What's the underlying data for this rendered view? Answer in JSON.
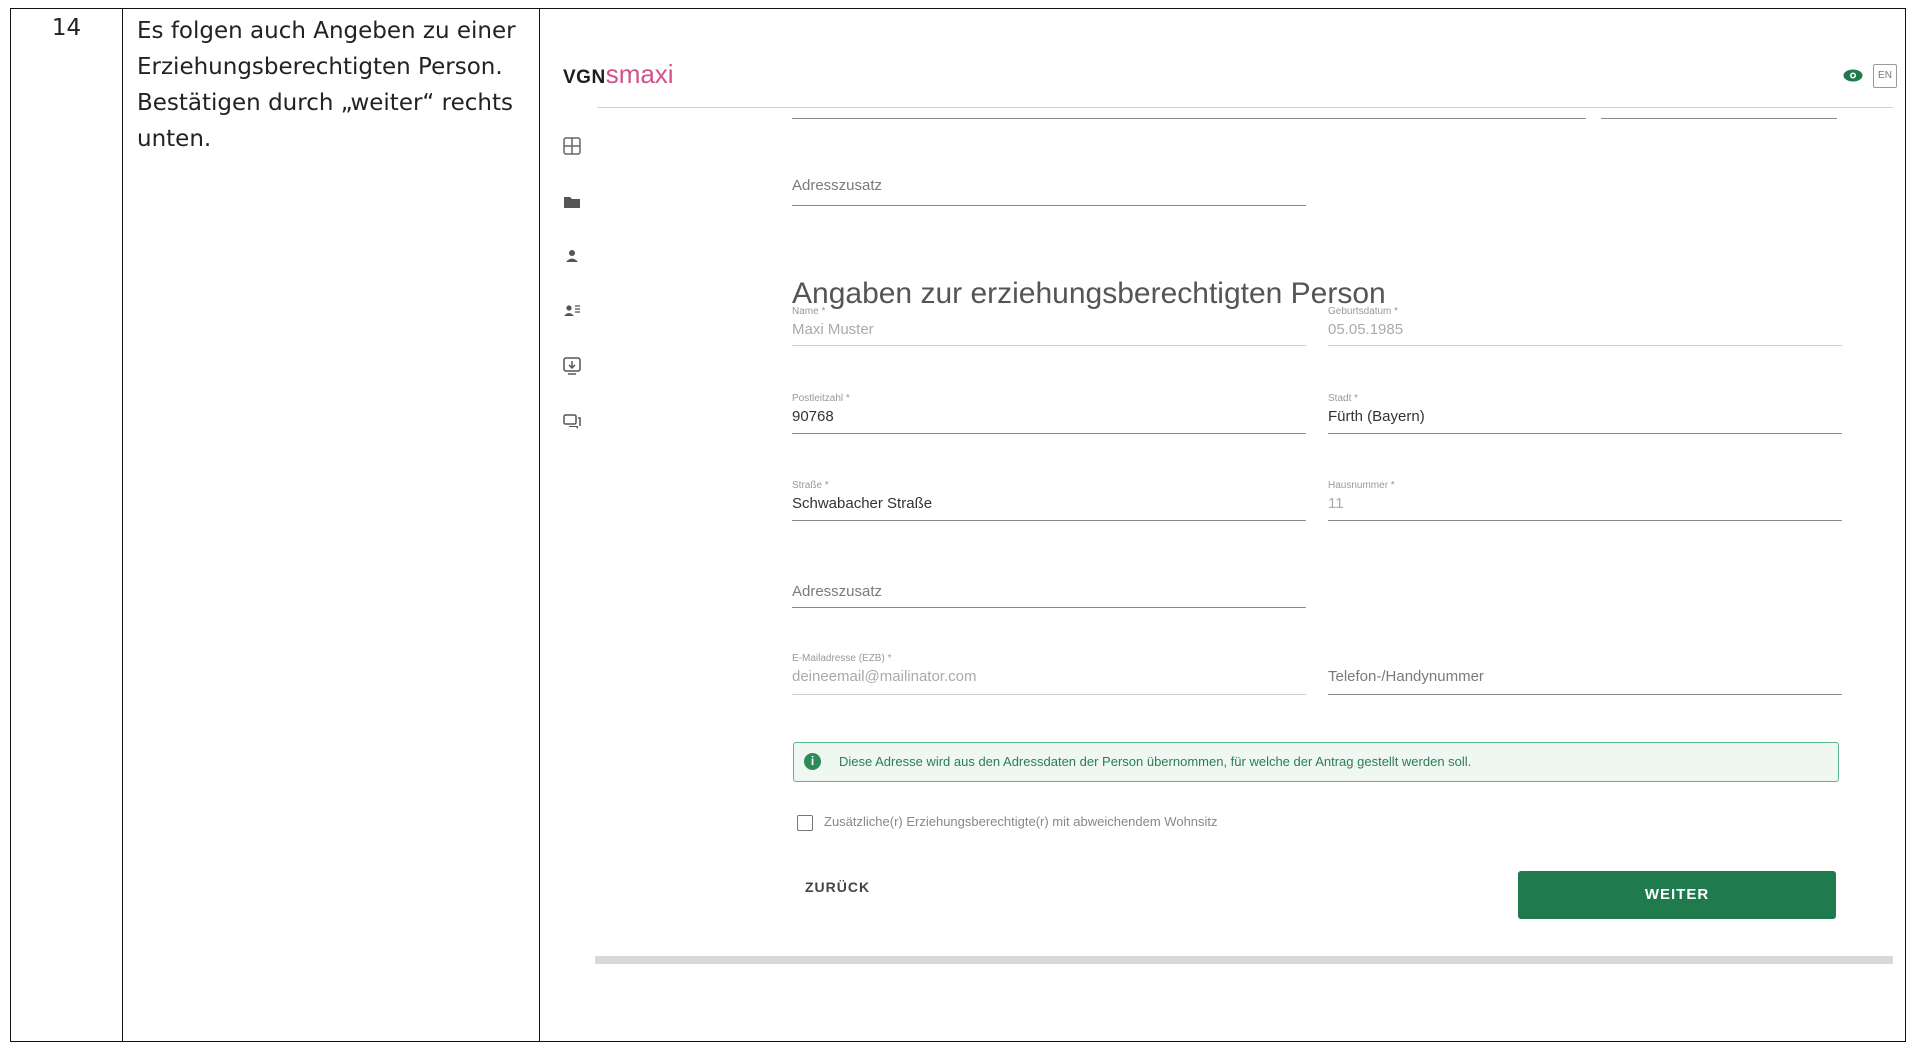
{
  "step": {
    "number": "14",
    "text": "Es folgen auch Angeben zu einer\nErziehungsberechtigten Person.\nBestätigen durch „weiter“ rechts\nunten."
  },
  "app": {
    "logo_vgn": "VGN",
    "logo_smaxi": "smaxi",
    "lang": "EN",
    "accent_color": "#1f7a4d",
    "brand_color": "#d4508a"
  },
  "sidebar": {
    "icons": [
      "dashboard-icon",
      "folder-icon",
      "person-icon",
      "person-list-icon",
      "download-icon",
      "chat-icon"
    ]
  },
  "form": {
    "address_extra_top": {
      "placeholder": "Adresszusatz"
    },
    "section_title": "Angaben zur erziehungsberechtigten Person",
    "name": {
      "label": "Name *",
      "value": "Maxi Muster"
    },
    "birthdate": {
      "label": "Geburtsdatum *",
      "value": "05.05.1985"
    },
    "postal_code": {
      "label": "Postleitzahl *",
      "value": "90768"
    },
    "city": {
      "label": "Stadt *",
      "value": "Fürth (Bayern)"
    },
    "street": {
      "label": "Straße *",
      "value": "Schwabacher Straße"
    },
    "house_number": {
      "label": "Hausnummer *",
      "value": "11"
    },
    "address_extra": {
      "placeholder": "Adresszusatz"
    },
    "email": {
      "label": "E-Mailadresse (EZB) *",
      "value": "deineemail@mailinator.com"
    },
    "phone": {
      "placeholder": "Telefon-/Handynummer"
    },
    "info": "Diese Adresse wird aus den Adressdaten der Person übernommen, für welche der Antrag gestellt werden soll.",
    "checkbox_label": "Zusätzliche(r) Erziehungsberechtigte(r) mit abweichendem Wohnsitz",
    "back": "ZURÜCK",
    "next": "WEITER"
  }
}
